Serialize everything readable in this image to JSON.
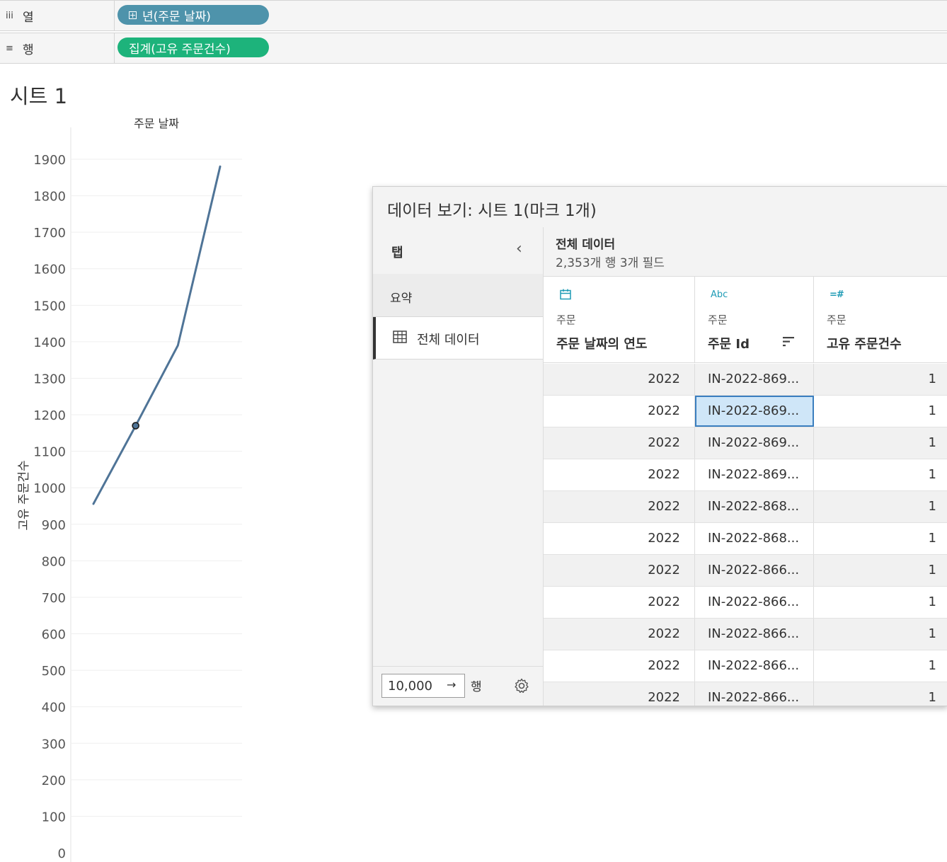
{
  "shelves": {
    "columns": {
      "icon": "iii",
      "label": "열",
      "pill": "년(주문 날짜)",
      "pill_prefix": "⊞"
    },
    "rows": {
      "icon": "≡",
      "label": "행",
      "pill": "집계(고유 주문건수)"
    }
  },
  "sheet_title": "시트 1",
  "chart_data": {
    "type": "line",
    "title": "주문 날짜",
    "ylabel": "고유 주문건수",
    "ylim": [
      0,
      1900
    ],
    "yticks": [
      0,
      100,
      200,
      300,
      400,
      500,
      600,
      700,
      800,
      900,
      1000,
      1100,
      1200,
      1300,
      1400,
      1500,
      1600,
      1700,
      1800,
      1900
    ],
    "x": [
      1,
      2,
      3,
      4
    ],
    "values": [
      956,
      1170,
      1390,
      1880
    ],
    "highlight_index": 1,
    "line_color": "#4f7497"
  },
  "panel": {
    "title": "데이터 보기: 시트 1(마크 1개)",
    "tabs_label": "탭",
    "collapse_icon": "chevron-left-icon",
    "summary_tab": "요약",
    "all_data_tab": "전체 데이터",
    "source_name": "전체 데이터",
    "source_meta": "2,353개 행 3개 필드",
    "rows_value": "10,000",
    "rows_label": "행",
    "columns": [
      {
        "type_label": "",
        "table": "주문",
        "field": "주문 날짜의 연도"
      },
      {
        "type_label": "Abc",
        "table": "주문",
        "field": "주문 Id"
      },
      {
        "type_label": "=#",
        "table": "주문",
        "field": "고유 주문건수"
      }
    ],
    "data_rows": [
      [
        "2022",
        "IN-2022-869...",
        "1"
      ],
      [
        "2022",
        "IN-2022-869...",
        "1"
      ],
      [
        "2022",
        "IN-2022-869...",
        "1"
      ],
      [
        "2022",
        "IN-2022-869...",
        "1"
      ],
      [
        "2022",
        "IN-2022-868...",
        "1"
      ],
      [
        "2022",
        "IN-2022-868...",
        "1"
      ],
      [
        "2022",
        "IN-2022-866...",
        "1"
      ],
      [
        "2022",
        "IN-2022-866...",
        "1"
      ],
      [
        "2022",
        "IN-2022-866...",
        "1"
      ],
      [
        "2022",
        "IN-2022-866...",
        "1"
      ],
      [
        "2022",
        "IN-2022-866...",
        "1"
      ]
    ],
    "selected_cell": [
      1,
      1
    ]
  }
}
